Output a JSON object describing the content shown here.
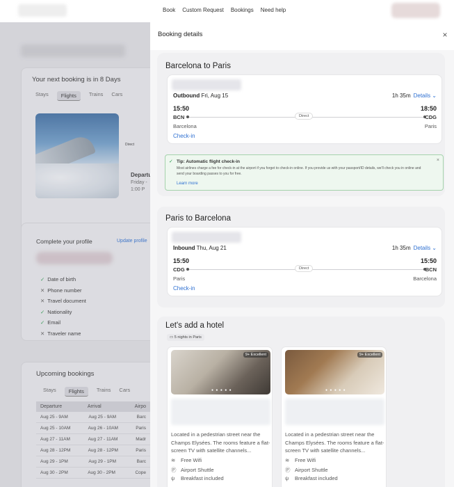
{
  "topnav": {
    "links": [
      "Book",
      "Custom Request",
      "Bookings",
      "Need help"
    ]
  },
  "background": {
    "next_booking": "Your next booking is in 8 Days",
    "tabs1": [
      "Stays",
      "Flights",
      "Trains",
      "Cars"
    ],
    "departure_label": "Departu",
    "departure_time_a": "Friday -",
    "departure_time_b": "1:00 P",
    "direct": "Direct",
    "profile_title": "Complete your profile",
    "update_profile": "Update profile",
    "profile_items": [
      {
        "label": "Date of birth",
        "done": true
      },
      {
        "label": "Phone number",
        "done": false
      },
      {
        "label": "Travel document",
        "done": false
      },
      {
        "label": "Nationality",
        "done": true
      },
      {
        "label": "Email",
        "done": true
      },
      {
        "label": "Traveler name",
        "done": false
      }
    ],
    "upcoming_title": "Upcoming bookings",
    "tabs2": [
      "Stays",
      "Flights",
      "Trains",
      "Cars"
    ],
    "table_headers": [
      "Departure",
      "Arrival",
      "Airpo"
    ],
    "table_rows": [
      [
        "Aug 25 - 9AM",
        "Aug 25 - 9AM",
        "Barc"
      ],
      [
        "Aug 25 - 10AM",
        "Aug 26 - 10AM",
        "Paris"
      ],
      [
        "Aug 27 - 11AM",
        "Aug 27 - 11AM",
        "Madr"
      ],
      [
        "Aug 28 - 12PM",
        "Aug 28 - 12PM",
        "Paris"
      ],
      [
        "Aug 29 - 1PM",
        "Aug 29 - 1PM",
        "Barc"
      ],
      [
        "Aug 30 - 2PM",
        "Aug 30 - 2PM",
        "Cope"
      ]
    ]
  },
  "panel": {
    "title": "Booking details",
    "close": "×",
    "outbound": {
      "section_title": "Barcelona to Paris",
      "direction": "Outbound",
      "date": "Fri, Aug 15",
      "duration": "1h 35m",
      "details": "Details",
      "dep_time": "15:50",
      "arr_time": "18:50",
      "dep_code": "BCN",
      "arr_code": "CDG",
      "dep_city": "Barcelona",
      "arr_city": "Paris",
      "direct": "Direct",
      "checkin": "Check-in"
    },
    "tip": {
      "title": "Tip: Automatic flight check-in",
      "body": "Most airlines charge a fee for check-in at the airport if you forget to check-in online. If you provide us with your passport/ID details, we'll check you in online and send your boarding passes to you for free.",
      "learn_more": "Learn more",
      "close": "×"
    },
    "inbound": {
      "section_title": "Paris to Barcelona",
      "direction": "Inbound",
      "date": "Thu, Aug 21",
      "duration": "1h 35m",
      "details": "Details",
      "dep_time": "15:50",
      "arr_time": "15:50",
      "dep_code": "CDG",
      "arr_code": "BCN",
      "dep_city": "Paris",
      "arr_city": "Barcelona",
      "direct": "Direct",
      "checkin": "Check-in"
    },
    "hotel": {
      "section_title": "Let's add a hotel",
      "nights_badge": "5 nights in Paris",
      "cards": [
        {
          "rating": "9+ Excellent",
          "description": "Located in a pedestrian street near the Champs Elysées. The rooms feature a flat-screen TV with satellite channels...",
          "amenities": [
            "Free Wifi",
            "Airport Shuttle",
            "Breakfast included"
          ]
        },
        {
          "rating": "9+ Excellent",
          "description": "Located in a pedestrian street near the Champs Elysées. The rooms feature a flat-screen TV with satellite channels...",
          "amenities": [
            "Free Wifi",
            "Airport Shuttle",
            "Breakfast included"
          ]
        }
      ]
    }
  },
  "colors": {
    "accent": "#2d6fd1",
    "success": "#2a9d4e",
    "tip_bg": "#eef7ef"
  }
}
